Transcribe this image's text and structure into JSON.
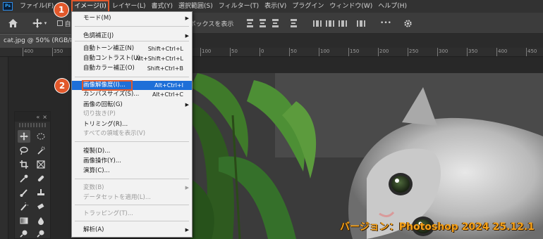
{
  "app": {
    "logo": "Ps"
  },
  "menubar": {
    "items": [
      {
        "label": "ファイル(F)"
      },
      {
        "label": "編"
      },
      {
        "label": "イメージ(I)"
      },
      {
        "label": "レイヤー(L)"
      },
      {
        "label": "書式(Y)"
      },
      {
        "label": "選択範囲(S)"
      },
      {
        "label": "フィルター(T)"
      },
      {
        "label": "表示(V)"
      },
      {
        "label": "プラグイン"
      },
      {
        "label": "ウィンドウ(W)"
      },
      {
        "label": "ヘルプ(H)"
      }
    ],
    "active_index": 2
  },
  "optionsbar": {
    "home_icon": "home-icon",
    "move_icon": "move-icon",
    "checkbox_label": "自",
    "show_transform_label": "ボックスを表示",
    "more_label": "•••",
    "gear_icon": "gear-icon"
  },
  "document": {
    "tab_label": "cat.jpg @ 50% (RGB/8)",
    "ruler_labels": [
      "400",
      "350",
      "300",
      "250",
      "200",
      "150",
      "100",
      "50",
      "0",
      "50",
      "100",
      "150",
      "200",
      "250",
      "300",
      "350",
      "400",
      "450"
    ]
  },
  "dropdown": {
    "items": [
      {
        "label": "モード(M)",
        "shortcut": "",
        "submenu": true,
        "disabled": false
      },
      {
        "label": "色調補正(J)",
        "shortcut": "",
        "submenu": true,
        "disabled": false
      },
      {
        "label": "自動トーン補正(N)",
        "shortcut": "Shift+Ctrl+L",
        "submenu": false,
        "disabled": false
      },
      {
        "label": "自動コントラスト(U)",
        "shortcut": "Alt+Shift+Ctrl+L",
        "submenu": false,
        "disabled": false
      },
      {
        "label": "自動カラー補正(O)",
        "shortcut": "Shift+Ctrl+B",
        "submenu": false,
        "disabled": false
      },
      {
        "label": "画像解像度(I)...",
        "shortcut": "Alt+Ctrl+I",
        "submenu": false,
        "disabled": false,
        "highlighted": true
      },
      {
        "label": "カンバスサイズ(S)...",
        "shortcut": "Alt+Ctrl+C",
        "submenu": false,
        "disabled": false
      },
      {
        "label": "画像の回転(G)",
        "shortcut": "",
        "submenu": true,
        "disabled": false
      },
      {
        "label": "切り抜き(P)",
        "shortcut": "",
        "submenu": false,
        "disabled": true
      },
      {
        "label": "トリミング(R)...",
        "shortcut": "",
        "submenu": false,
        "disabled": false
      },
      {
        "label": "すべての領域を表示(V)",
        "shortcut": "",
        "submenu": false,
        "disabled": true
      },
      {
        "label": "複製(D)...",
        "shortcut": "",
        "submenu": false,
        "disabled": false
      },
      {
        "label": "画像操作(Y)...",
        "shortcut": "",
        "submenu": false,
        "disabled": false
      },
      {
        "label": "演算(C)...",
        "shortcut": "",
        "submenu": false,
        "disabled": false
      },
      {
        "label": "変数(B)",
        "shortcut": "",
        "submenu": true,
        "disabled": true
      },
      {
        "label": "データセットを適用(L)...",
        "shortcut": "",
        "submenu": false,
        "disabled": true
      },
      {
        "label": "トラッピング(T)...",
        "shortcut": "",
        "submenu": false,
        "disabled": true
      },
      {
        "label": "解析(A)",
        "shortcut": "",
        "submenu": true,
        "disabled": false
      }
    ]
  },
  "callouts": {
    "step1": "1",
    "step2": "2"
  },
  "watermark": {
    "text": "バージョン：Photoshop 2024 25.12.1"
  },
  "colors": {
    "accent": "#e2582b",
    "highlight": "#1e6fd8",
    "watermark": "#f6a21a"
  }
}
